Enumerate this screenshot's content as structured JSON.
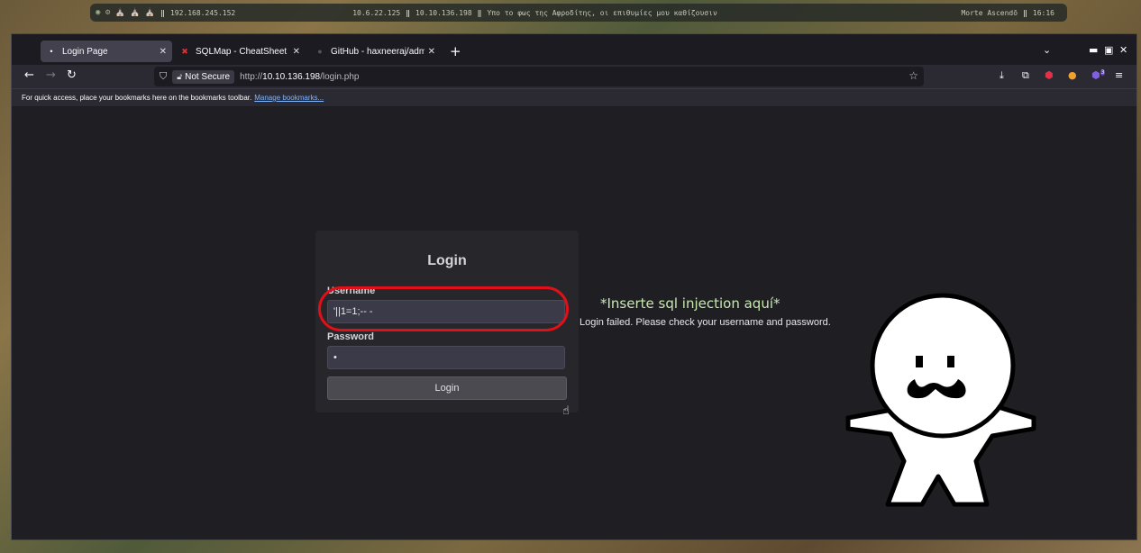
{
  "topbar": {
    "ip_local": "192.168.245.152",
    "ip_tun": "10.6.22.125",
    "ip_target": "10.10.136.198",
    "quote": "Υπο το φως της Αφροδίτης, οι επιθυμίες μου καθίζουσιν",
    "spell": "Morte Ascendō",
    "clock": "16:16"
  },
  "tabs": [
    {
      "label": "Login Page",
      "active": true
    },
    {
      "label": "SQLMap - CheatSheet - Ha",
      "active": false
    },
    {
      "label": "GitHub - haxneeraj/admin-",
      "active": false
    }
  ],
  "nav": {
    "security_label": "Not Secure",
    "url_prefix": "http://",
    "url_host": "10.10.136.198",
    "url_path": "/login.php",
    "notification_count": "3"
  },
  "bookmarks": {
    "hint": "For quick access, place your bookmarks here on the bookmarks toolbar.",
    "manage_link": "Manage bookmarks..."
  },
  "login": {
    "title": "Login",
    "username_label": "Username",
    "username_value": "'||1=1;-- -",
    "password_label": "Password",
    "password_value": "•",
    "button_label": "Login"
  },
  "annotation": "*Inserte sql injection aquí*",
  "message": "Login failed. Please check your username and password.",
  "colors": {
    "highlight_ring": "#e0101a",
    "annotation_text": "#c8e8b0"
  }
}
